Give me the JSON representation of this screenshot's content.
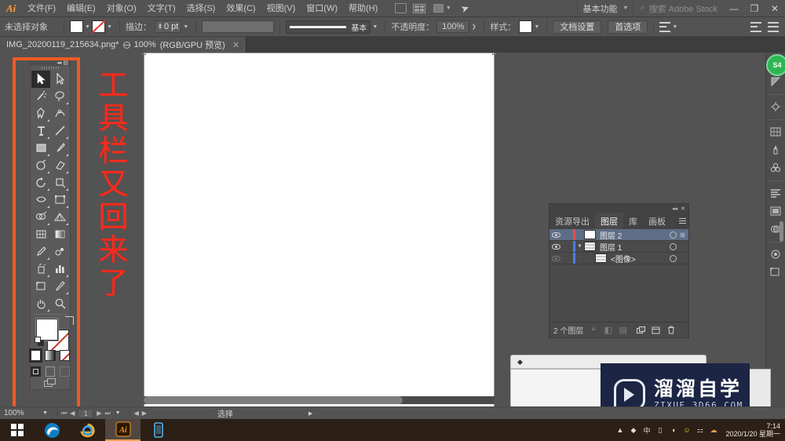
{
  "app": {
    "name": "Adobe Illustrator",
    "logo_text": "Ai"
  },
  "menubar": {
    "items": [
      {
        "label": "文件(F)",
        "name": "menu-file"
      },
      {
        "label": "编辑(E)",
        "name": "menu-edit"
      },
      {
        "label": "对象(O)",
        "name": "menu-object"
      },
      {
        "label": "文字(T)",
        "name": "menu-type"
      },
      {
        "label": "选择(S)",
        "name": "menu-select"
      },
      {
        "label": "效果(C)",
        "name": "menu-effect"
      },
      {
        "label": "视图(V)",
        "name": "menu-view"
      },
      {
        "label": "窗口(W)",
        "name": "menu-window"
      },
      {
        "label": "帮助(H)",
        "name": "menu-help"
      }
    ],
    "workspace": "基本功能",
    "stock_search": "搜索 Adobe Stock",
    "window_buttons": {
      "minimize": "—",
      "restore": "❐",
      "close": "✕"
    }
  },
  "optionsbar": {
    "selection_status": "未选择对象",
    "stroke_label": "描边：",
    "stroke_value": "0 pt",
    "stroke_profile": "基本",
    "opacity_label": "不透明度：",
    "opacity_value": "100%",
    "style_label": "样式：",
    "document_setup": "文档设置",
    "preferences": "首选项"
  },
  "tabbar": {
    "document_title": "IMG_20200119_215634.png*",
    "zoom": "100%",
    "color_mode": "(RGB/GPU 预览)",
    "at_symbol": "@",
    "close": "✕"
  },
  "toolbar": {
    "tools": [
      {
        "name": "selection-tool",
        "glyph": "arrow",
        "active": true
      },
      {
        "name": "direct-selection-tool",
        "glyph": "arrow-white",
        "active": false
      },
      {
        "name": "magic-wand-tool",
        "glyph": "wand",
        "active": false
      },
      {
        "name": "lasso-tool",
        "glyph": "lasso",
        "active": false
      },
      {
        "name": "pen-tool",
        "glyph": "pen",
        "active": false
      },
      {
        "name": "curvature-tool",
        "glyph": "curvature",
        "active": false
      },
      {
        "name": "type-tool",
        "glyph": "type",
        "active": false
      },
      {
        "name": "line-segment-tool",
        "glyph": "line",
        "active": false
      },
      {
        "name": "rectangle-tool",
        "glyph": "rect",
        "active": false
      },
      {
        "name": "paintbrush-tool",
        "glyph": "brush",
        "active": false
      },
      {
        "name": "shaper-tool",
        "glyph": "shaper",
        "active": false
      },
      {
        "name": "eraser-tool",
        "glyph": "eraser",
        "active": false
      },
      {
        "name": "rotate-tool",
        "glyph": "rotate",
        "active": false
      },
      {
        "name": "scale-tool",
        "glyph": "scale",
        "active": false
      },
      {
        "name": "width-tool",
        "glyph": "width",
        "active": false
      },
      {
        "name": "free-transform-tool",
        "glyph": "freetransform",
        "active": false
      },
      {
        "name": "shape-builder-tool",
        "glyph": "shapebuilder",
        "active": false
      },
      {
        "name": "perspective-grid-tool",
        "glyph": "perspective",
        "active": false
      },
      {
        "name": "mesh-tool",
        "glyph": "mesh",
        "active": false
      },
      {
        "name": "gradient-tool",
        "glyph": "gradient",
        "active": false
      },
      {
        "name": "eyedropper-tool",
        "glyph": "eyedropper",
        "active": false
      },
      {
        "name": "blend-tool",
        "glyph": "blend",
        "active": false
      },
      {
        "name": "symbol-sprayer-tool",
        "glyph": "symbol",
        "active": false
      },
      {
        "name": "column-graph-tool",
        "glyph": "graph",
        "active": false
      },
      {
        "name": "artboard-tool",
        "glyph": "artboard",
        "active": false
      },
      {
        "name": "slice-tool",
        "glyph": "slice",
        "active": false
      },
      {
        "name": "hand-tool",
        "glyph": "hand",
        "active": false
      },
      {
        "name": "zoom-tool",
        "glyph": "zoom",
        "active": false
      }
    ],
    "fill_color": "#ffffff",
    "stroke_color": "none",
    "color_modes": [
      "color",
      "gradient",
      "none"
    ],
    "screen_modes": [
      "normal-screen-mode",
      "full-screen-with-menu",
      "full-screen"
    ]
  },
  "annotation": {
    "text": "工具栏又回来了",
    "color": "#ff2b1a",
    "highlight_color": "#f05a22"
  },
  "layers_panel": {
    "tabs": [
      {
        "label": "资源导出",
        "active": false
      },
      {
        "label": "图层",
        "active": true
      },
      {
        "label": "库",
        "active": false
      },
      {
        "label": "画板",
        "active": false
      }
    ],
    "rows": [
      {
        "name": "图层 2",
        "visible": true,
        "selected": true,
        "indent": 0,
        "type": "layer",
        "color": "#e04f4f"
      },
      {
        "name": "图层 1",
        "visible": true,
        "selected": false,
        "indent": 0,
        "type": "layer",
        "color": "#4f7fe0",
        "expanded": true
      },
      {
        "name": "<图像>",
        "visible": false,
        "selected": false,
        "indent": 1,
        "type": "image",
        "color": "#4f7fe0"
      }
    ],
    "footer_count": "2 个图层"
  },
  "statusbar": {
    "zoom": "100%",
    "page": "1",
    "tool": "选择"
  },
  "watermark": {
    "title": "溜溜自学",
    "url": "ZIXUE.3D66.COM",
    "bg": "#1c2544"
  },
  "taskbar": {
    "apps": [
      {
        "name": "taskbar-start",
        "label": "Windows"
      },
      {
        "name": "taskbar-edge",
        "label": "Microsoft Edge"
      },
      {
        "name": "taskbar-ie",
        "label": "Internet Explorer"
      },
      {
        "name": "taskbar-illustrator",
        "label": "Adobe Illustrator",
        "active": true
      },
      {
        "name": "taskbar-app",
        "label": "App"
      }
    ],
    "clock_time": "7:14",
    "clock_date": "2020/1/20 星期一"
  }
}
